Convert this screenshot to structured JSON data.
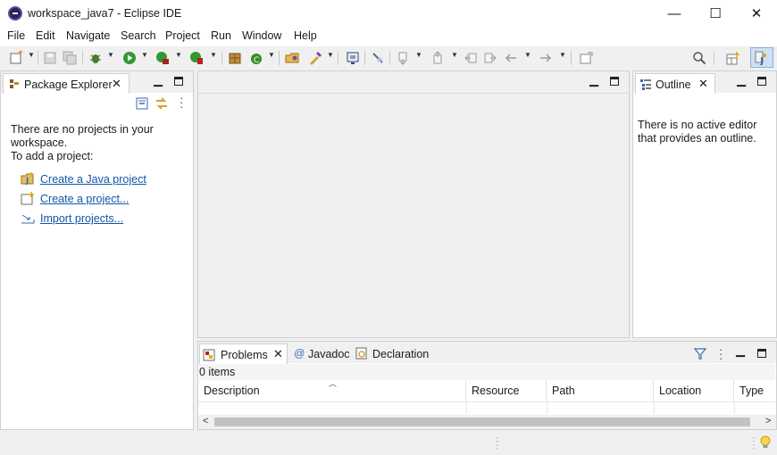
{
  "window": {
    "title": "workspace_java7 - Eclipse IDE",
    "minimize_glyph": "—",
    "maximize_glyph": "☐",
    "close_glyph": "✕"
  },
  "menu": [
    "File",
    "Edit",
    "Navigate",
    "Search",
    "Project",
    "Run",
    "Window",
    "Help"
  ],
  "package_explorer": {
    "tab_label": "Package Explorer",
    "message_line1": "There are no projects in your",
    "message_line2": "workspace.",
    "message_line3": "To add a project:",
    "links": [
      "Create a Java project",
      "Create a project...",
      "Import projects..."
    ]
  },
  "outline": {
    "tab_label": "Outline",
    "message_line1": "There is no active editor",
    "message_line2": "that provides an outline."
  },
  "bottom": {
    "tabs": [
      "Problems",
      "Javadoc",
      "Declaration"
    ],
    "status": "0 items",
    "columns": [
      "Description",
      "Resource",
      "Path",
      "Location",
      "Type"
    ]
  },
  "colors": {
    "accent": "#1155aa",
    "panel_border": "#d0d0d0",
    "background": "#f0f0f0"
  }
}
